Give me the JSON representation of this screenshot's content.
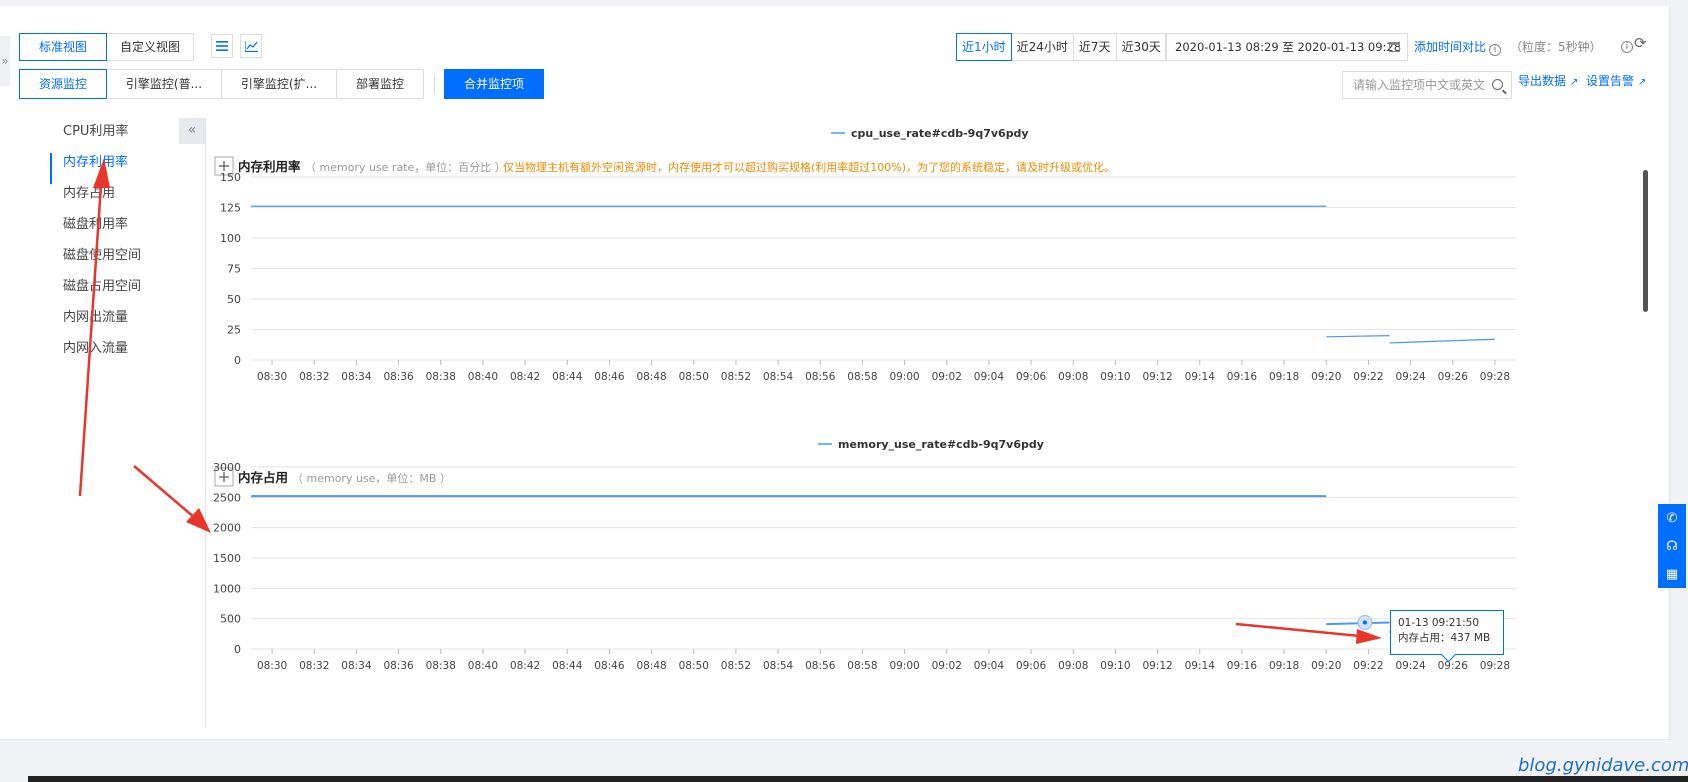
{
  "toolbar": {
    "view_buttons": [
      "标准视图",
      "自定义视图"
    ],
    "time_buttons": [
      "近1小时",
      "近24小时",
      "近7天",
      "近30天"
    ],
    "date_range": "2020-01-13 08:29 至 2020-01-13 09:28",
    "add_compare": "添加时间对比",
    "granularity": "（粒度：5秒钟）"
  },
  "tabs": [
    "资源监控",
    "引擎监控(普...",
    "引擎监控(扩...",
    "部署监控"
  ],
  "merge_button": "合并监控项",
  "search": {
    "placeholder": "请输入监控项中文或英文"
  },
  "export_label": "导出数据",
  "alarm_label": "设置告警",
  "sidebar": {
    "items": [
      "CPU利用率",
      "内存利用率",
      "内存占用",
      "磁盘利用率",
      "磁盘使用空间",
      "磁盘占用空间",
      "内网出流量",
      "内网入流量"
    ],
    "active_index": 1
  },
  "charts": {
    "memory_rate": {
      "legend": "cpu_use_rate#cdb-9q7v6pdy",
      "title": "内存利用率",
      "subtitle": "（ memory use rate，单位：百分比 ）",
      "note": "仅当物理主机有额外空闲资源时，内存使用才可以超过购买规格(利用率超过100%)，为了您的系统稳定，请及时升级或优化。"
    },
    "memory_use": {
      "legend": "memory_use_rate#cdb-9q7v6pdy",
      "title": "内存占用",
      "subtitle": "（ memory use，单位：MB ）"
    }
  },
  "tooltip": {
    "time": "01-13 09:21:50",
    "value": "内存占用：437 MB"
  },
  "watermark": "blog.gynidave.com",
  "colors": {
    "accent": "#006eff",
    "line": "#4a9ae8",
    "note": "#f08c00"
  },
  "chart_data": [
    {
      "type": "line",
      "x": [
        "08:30",
        "08:32",
        "08:34",
        "08:36",
        "08:38",
        "08:40",
        "08:42",
        "08:44",
        "08:46",
        "08:48",
        "08:50",
        "08:52",
        "08:54",
        "08:56",
        "08:58",
        "09:00",
        "09:02",
        "09:04",
        "09:06",
        "09:08",
        "09:10",
        "09:12",
        "09:14",
        "09:16",
        "09:18",
        "09:20",
        "09:22",
        "09:24",
        "09:26",
        "09:28"
      ],
      "series": [
        {
          "name": "cpu_use_rate#cdb-9q7v6pdy",
          "segments": [
            {
              "x": [
                "08:29",
                "09:20"
              ],
              "values": [
                126,
                126
              ]
            },
            {
              "x": [
                "09:20",
                "09:23"
              ],
              "values": [
                19,
                20
              ]
            },
            {
              "x": [
                "09:23",
                "09:28"
              ],
              "values": [
                14,
                17
              ]
            }
          ]
        }
      ],
      "ylim": [
        0,
        150
      ],
      "yticks": [
        0,
        25,
        50,
        75,
        100,
        125,
        150
      ],
      "grid": true,
      "legend": "top-center"
    },
    {
      "type": "line",
      "x": [
        "08:30",
        "08:32",
        "08:34",
        "08:36",
        "08:38",
        "08:40",
        "08:42",
        "08:44",
        "08:46",
        "08:48",
        "08:50",
        "08:52",
        "08:54",
        "08:56",
        "08:58",
        "09:00",
        "09:02",
        "09:04",
        "09:06",
        "09:08",
        "09:10",
        "09:12",
        "09:14",
        "09:16",
        "09:18",
        "09:20",
        "09:22",
        "09:24",
        "09:26",
        "09:28"
      ],
      "series": [
        {
          "name": "memory_use_rate#cdb-9q7v6pdy",
          "segments": [
            {
              "x": [
                "08:29",
                "09:20"
              ],
              "values": [
                2520,
                2520
              ]
            },
            {
              "x": [
                "09:20",
                "09:23"
              ],
              "values": [
                410,
                437
              ]
            },
            {
              "x": [
                "09:23",
                "09:28"
              ],
              "values": [
                280,
                330
              ]
            }
          ]
        }
      ],
      "ylim": [
        0,
        3000
      ],
      "yticks": [
        0,
        500,
        1000,
        1500,
        2000,
        2500,
        3000
      ],
      "grid": true,
      "legend": "top-center"
    }
  ]
}
